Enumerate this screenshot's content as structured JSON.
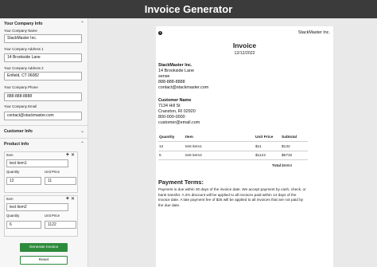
{
  "app": {
    "title": "Invoice Generator"
  },
  "sidebar": {
    "company_section": {
      "title": "Your Company Info",
      "chevron": "chevron-up-icon"
    },
    "fields": {
      "company_name": {
        "label": "Your Company Name",
        "value": "StackMaster Inc."
      },
      "address1": {
        "label": "Your Company Address 1",
        "value": "14 Brookside Lane"
      },
      "address2": {
        "label": "Your Company Address 2",
        "value": "Enfield, CT 06082"
      },
      "phone": {
        "label": "Your Company Phone",
        "value": "888-888-8888"
      },
      "email": {
        "label": "Your Company Email",
        "value": "contact@stackmaster.com"
      }
    },
    "customer_section": {
      "title": "Customer Info",
      "chevron": "chevron-down-icon"
    },
    "product_section": {
      "title": "Product Info",
      "chevron": "chevron-up-icon"
    },
    "items": [
      {
        "item_label": "Item",
        "item_value": "test item1",
        "qty_label": "Quantity",
        "qty_value": "12",
        "price_label": "Unit Price",
        "price_value": "11",
        "add": "+",
        "remove": "✕"
      },
      {
        "item_label": "Item",
        "item_value": "test item2",
        "qty_label": "Quantity",
        "qty_value": "6",
        "price_label": "Unit Price",
        "price_value": "1122",
        "add": "+",
        "remove": "✕"
      }
    ],
    "generate_label": "Generate Invoice",
    "reset_label": "Reset"
  },
  "invoice": {
    "info_glyph": "i",
    "company_top": "StackMaster Inc.",
    "title": "Invoice",
    "date": "12/12/2022",
    "from": {
      "name": "StackMaster Inc.",
      "address1": "14 Brookside Lane",
      "address2": "sense",
      "phone": "888-888-8888",
      "email": "contact@stackmaster.com"
    },
    "customer": {
      "heading": "Customer Name",
      "address1": "7134 Hill St",
      "address2": "Cranston, RI 02920",
      "phone": "800-000-0000",
      "email": "customer@email.com"
    },
    "table": {
      "headers": [
        "Quantity",
        "Item",
        "Unit Price",
        "Subtotal"
      ],
      "rows": [
        [
          "12",
          "test item1",
          "$11",
          "$132"
        ],
        [
          "6",
          "test item2",
          "$1122",
          "$6732"
        ]
      ],
      "total_label": "Total",
      "total_value": "$6864"
    },
    "terms": {
      "heading": "Payment Terms:",
      "text": "Payment is due within 30 days of the invoice date. We accept payment by cash, check, or bank transfer. A 2% discount will be applied to all invoices paid within 14 days of the invoice date. A late payment fee of $25 will be applied to all invoices that are not paid by the due date."
    }
  },
  "colors": {
    "header_bg": "#3b3b3b",
    "primary_green": "#2e8b3c",
    "sidebar_bg": "#f6f6f6",
    "canvas_bg": "#e9e9e9"
  }
}
